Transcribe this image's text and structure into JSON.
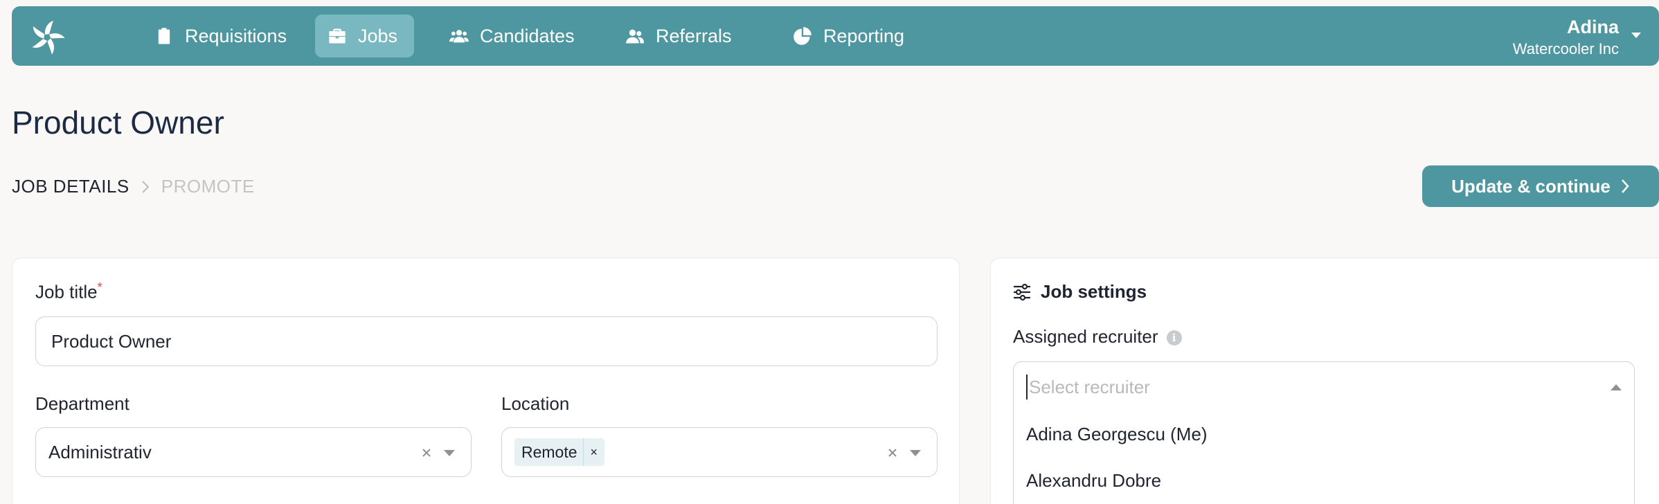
{
  "nav": {
    "items": [
      {
        "label": "Requisitions",
        "icon": "clipboard-icon",
        "active": false
      },
      {
        "label": "Jobs",
        "icon": "briefcase-icon",
        "active": true
      },
      {
        "label": "Candidates",
        "icon": "users-icon",
        "active": false
      },
      {
        "label": "Referrals",
        "icon": "user-pair-icon",
        "active": false
      },
      {
        "label": "Reporting",
        "icon": "pie-chart-icon",
        "active": false
      }
    ],
    "user": {
      "name": "Adina",
      "org": "Watercooler Inc"
    }
  },
  "page": {
    "title": "Product Owner",
    "steps": {
      "current": "JOB DETAILS",
      "next": "PROMOTE"
    },
    "primary_action": "Update & continue"
  },
  "job_details": {
    "job_title_label": "Job title",
    "required_mark": "*",
    "job_title_value": "Product Owner",
    "department_label": "Department",
    "department_value": "Administrativ",
    "location_label": "Location",
    "location_tag": "Remote",
    "tag_remove": "×"
  },
  "job_settings": {
    "heading": "Job settings",
    "assigned_recruiter_label": "Assigned recruiter",
    "info_glyph": "i",
    "recruiter_placeholder": "Select recruiter",
    "recruiter_options": [
      "Adina Georgescu (Me)",
      "Alexandru Dobre"
    ]
  },
  "colors": {
    "brand": "#4f97a0",
    "active_nav": "#79b8c0",
    "background": "#f9f8f6",
    "required": "#e0464a"
  }
}
